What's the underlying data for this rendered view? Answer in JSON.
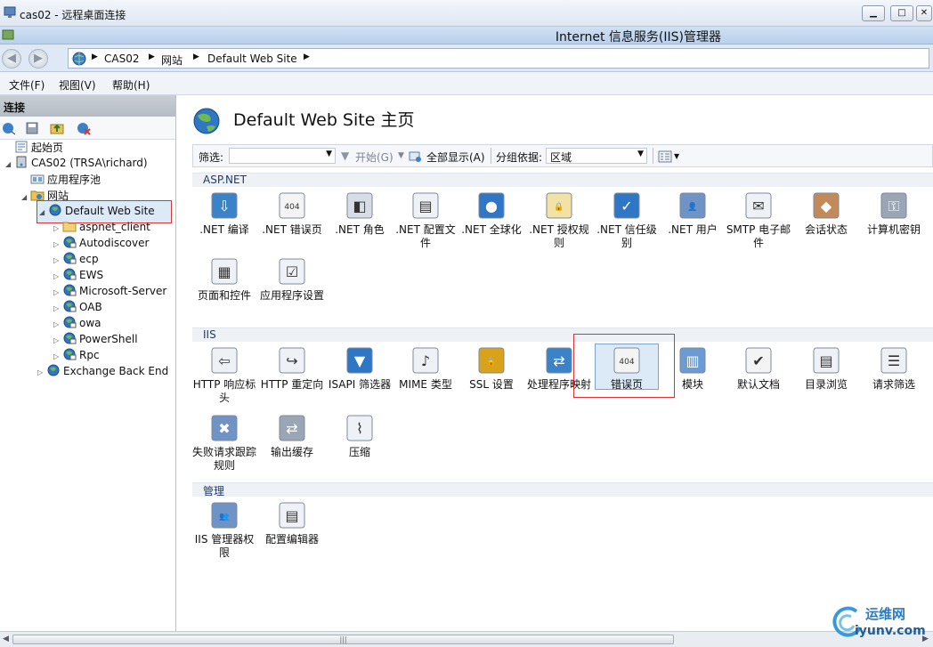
{
  "remote_desktop": {
    "title": "cas02 - 远程桌面连接"
  },
  "app": {
    "title": "Internet 信息服务(IIS)管理器"
  },
  "breadcrumb": [
    "CAS02",
    "网站",
    "Default Web Site"
  ],
  "menu": [
    "文件(F)",
    "视图(V)",
    "帮助(H)"
  ],
  "left_pane": {
    "header": "连接",
    "tree": [
      {
        "label": "起始页",
        "level": 0,
        "icon": "start-page-icon"
      },
      {
        "label": "CAS02 (TRSA\\richard)",
        "level": 0,
        "icon": "server-icon",
        "expanded": true
      },
      {
        "label": "应用程序池",
        "level": 1,
        "icon": "app-pool-icon"
      },
      {
        "label": "网站",
        "level": 1,
        "icon": "sites-folder-icon",
        "expanded": true
      },
      {
        "label": "Default Web Site",
        "level": 2,
        "icon": "globe-icon",
        "expanded": true,
        "selected": true
      },
      {
        "label": "aspnet_client",
        "level": 3,
        "icon": "folder-icon"
      },
      {
        "label": "Autodiscover",
        "level": 3,
        "icon": "app-icon"
      },
      {
        "label": "ecp",
        "level": 3,
        "icon": "app-icon"
      },
      {
        "label": "EWS",
        "level": 3,
        "icon": "app-icon"
      },
      {
        "label": "Microsoft-Server",
        "level": 3,
        "icon": "app-icon"
      },
      {
        "label": "OAB",
        "level": 3,
        "icon": "app-icon"
      },
      {
        "label": "owa",
        "level": 3,
        "icon": "app-icon"
      },
      {
        "label": "PowerShell",
        "level": 3,
        "icon": "app-icon"
      },
      {
        "label": "Rpc",
        "level": 3,
        "icon": "app-icon"
      },
      {
        "label": "Exchange Back End",
        "level": 2,
        "icon": "globe-icon"
      }
    ]
  },
  "main": {
    "title": "Default Web Site 主页",
    "filter": {
      "label": "筛选:",
      "start": "开始(G)",
      "show_all": "全部显示(A)",
      "group_by_label": "分组依据:",
      "group_by_value": "区域"
    },
    "sections": [
      {
        "name": "ASP.NET",
        "items": [
          ".NET 编译",
          ".NET 错误页",
          ".NET 角色",
          ".NET 配置文件",
          ".NET 全球化",
          ".NET 授权规则",
          ".NET 信任级别",
          ".NET 用户",
          "SMTP 电子邮件",
          "会话状态",
          "计算机密钥",
          "页面和控件",
          "应用程序设置"
        ]
      },
      {
        "name": "IIS",
        "items": [
          "HTTP 响应标头",
          "HTTP 重定向",
          "ISAPI 筛选器",
          "MIME 类型",
          "SSL 设置",
          "处理程序映射",
          "错误页",
          "模块",
          "默认文档",
          "目录浏览",
          "请求筛选",
          "失败请求跟踪规则",
          "输出缓存",
          "压缩"
        ]
      },
      {
        "name": "管理",
        "items": [
          "IIS 管理器权限",
          "配置编辑器"
        ]
      }
    ],
    "selected_feature": "错误页"
  },
  "watermark": {
    "line1": "运维网",
    "line2": "iyunv.com"
  },
  "colors": {
    "accent": "#1d3a6e",
    "selection": "#dceaf8",
    "highlight_box": "#dd3333"
  }
}
